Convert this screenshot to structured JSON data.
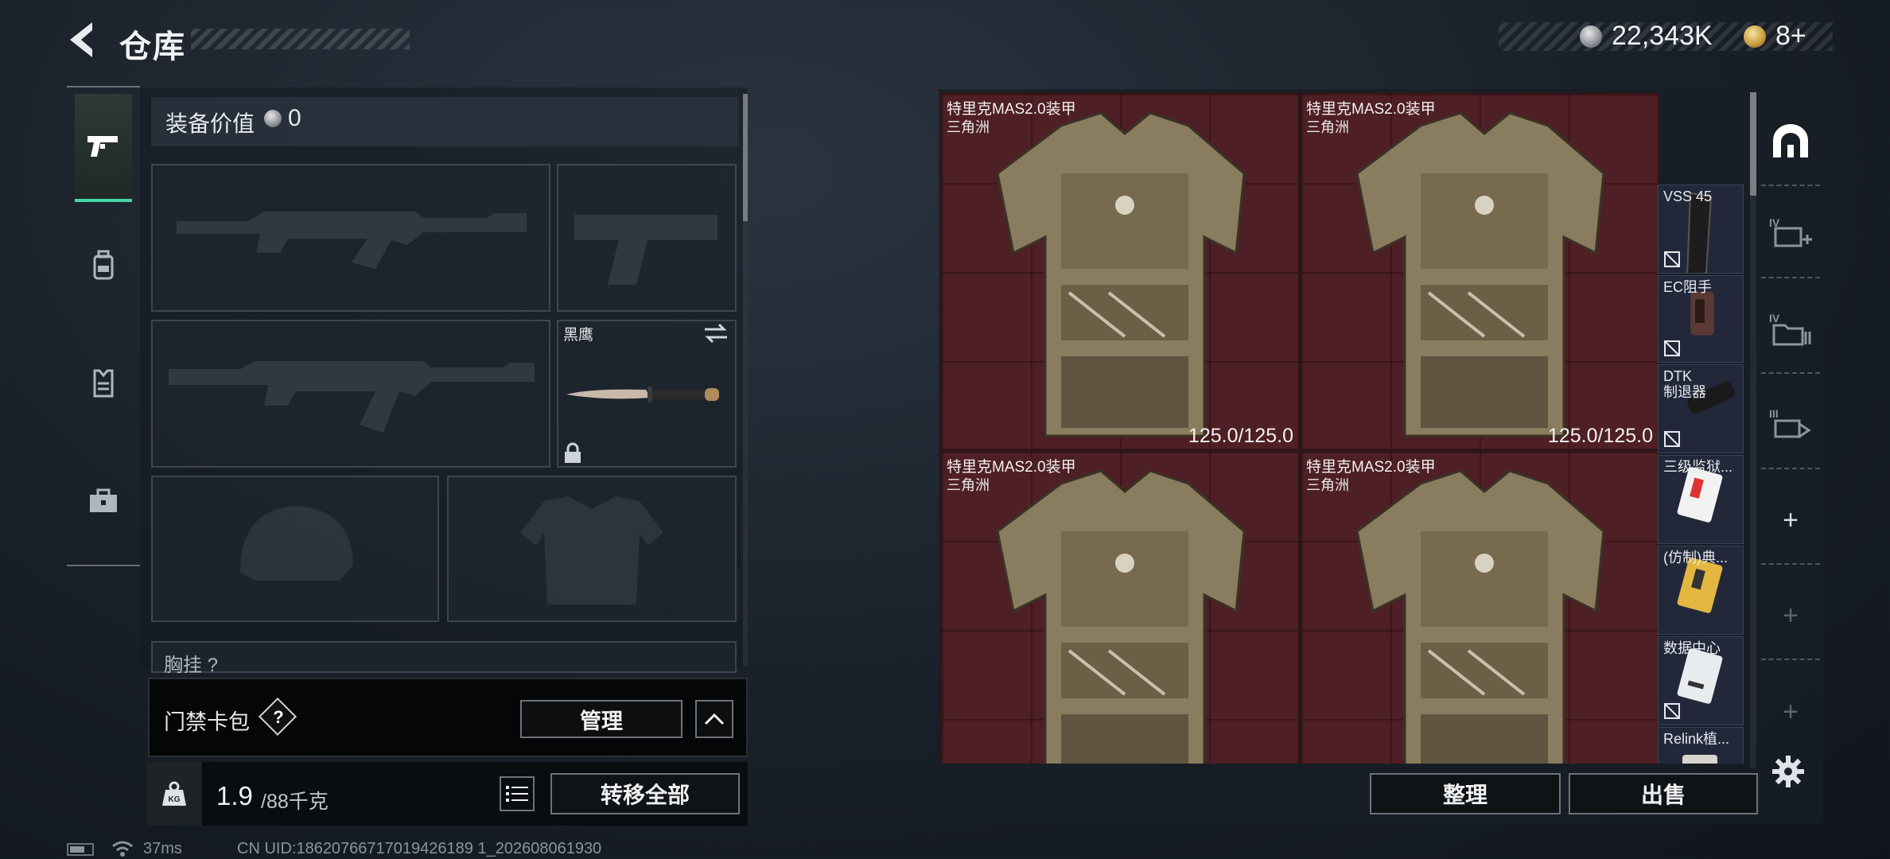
{
  "header": {
    "title": "仓库",
    "money": "22,343K",
    "gold": "8+"
  },
  "rail": {
    "items": [
      {
        "icon": "pistol-icon",
        "active": true
      },
      {
        "icon": "backpack-icon",
        "active": false
      },
      {
        "icon": "vest-icon",
        "active": false
      },
      {
        "icon": "toolbox-icon",
        "active": false
      }
    ]
  },
  "equipment": {
    "value_label": "装备价值",
    "value": "0",
    "melee_name": "黑鹰",
    "chest_label": "胸挂 ?"
  },
  "keycard": {
    "label": "门禁卡包",
    "help": "?",
    "manage_label": "管理"
  },
  "weight": {
    "current": "1.9",
    "capacity": "/88千克",
    "transfer_label": "转移全部"
  },
  "status": {
    "ping": "37ms",
    "uid": "CN UID:18620766717019426189 1_202608061930"
  },
  "stash": {
    "armor_items": [
      {
        "name": "特里克MAS2.0装甲",
        "sub": "三角洲",
        "durability": "125.0/125.0"
      },
      {
        "name": "特里克MAS2.0装甲",
        "sub": "三角洲",
        "durability": "125.0/125.0"
      },
      {
        "name": "特里克MAS2.0装甲",
        "sub": "三角洲",
        "durability": ""
      },
      {
        "name": "特里克MAS2.0装甲",
        "sub": "三角洲",
        "durability": ""
      }
    ],
    "side_items": [
      {
        "label": "VSS 45",
        "icon": "magazine-icon"
      },
      {
        "label": "EC阻手",
        "icon": "grip-icon"
      },
      {
        "label": "DTK\n制退器",
        "icon": "muzzle-brake-icon"
      },
      {
        "label": "三级监狱...",
        "icon": "keycard-icon"
      },
      {
        "label": "(仿制)典...",
        "icon": "gold-card-icon"
      },
      {
        "label": "数据中心",
        "icon": "white-card-icon"
      },
      {
        "label": "Relink植...",
        "icon": "implant-icon"
      }
    ],
    "sort_label": "整理",
    "sell_label": "出售"
  },
  "store_rail": {
    "items": [
      "bunker-icon",
      "IV",
      "IV",
      "III"
    ]
  },
  "colors": {
    "accent": "#46d6a8",
    "armor_cell": "#4e1f24",
    "side_cell": "#22283a"
  }
}
